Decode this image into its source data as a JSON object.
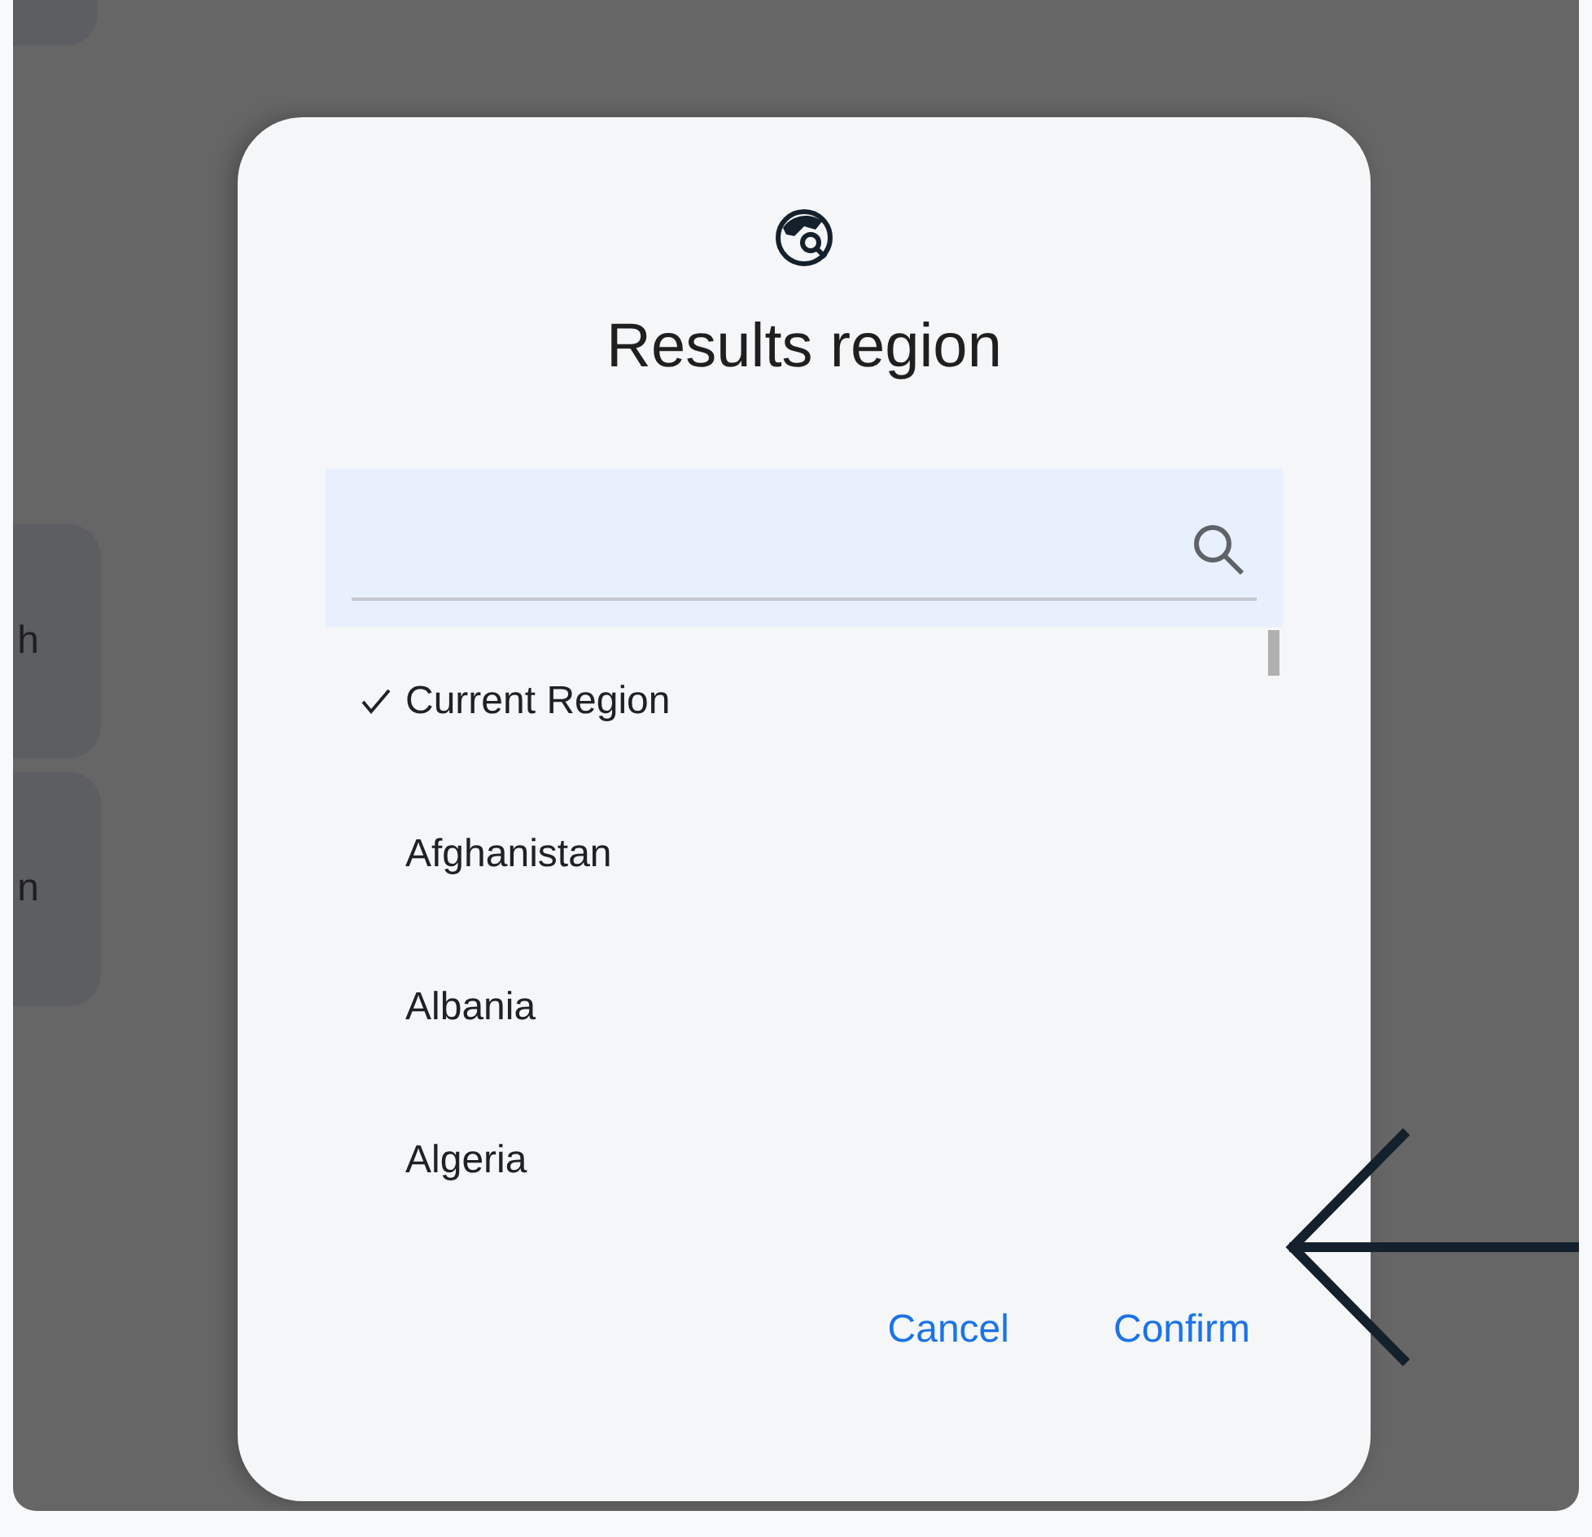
{
  "background": {
    "cards": [
      {
        "label": "h"
      },
      {
        "label": "n"
      }
    ]
  },
  "dialog": {
    "title": "Results region",
    "options": [
      {
        "label": "Current Region",
        "selected": true
      },
      {
        "label": "Afghanistan",
        "selected": false
      },
      {
        "label": "Albania",
        "selected": false
      },
      {
        "label": "Algeria",
        "selected": false
      }
    ],
    "buttons": [
      "Cancel",
      "Confirm"
    ]
  }
}
